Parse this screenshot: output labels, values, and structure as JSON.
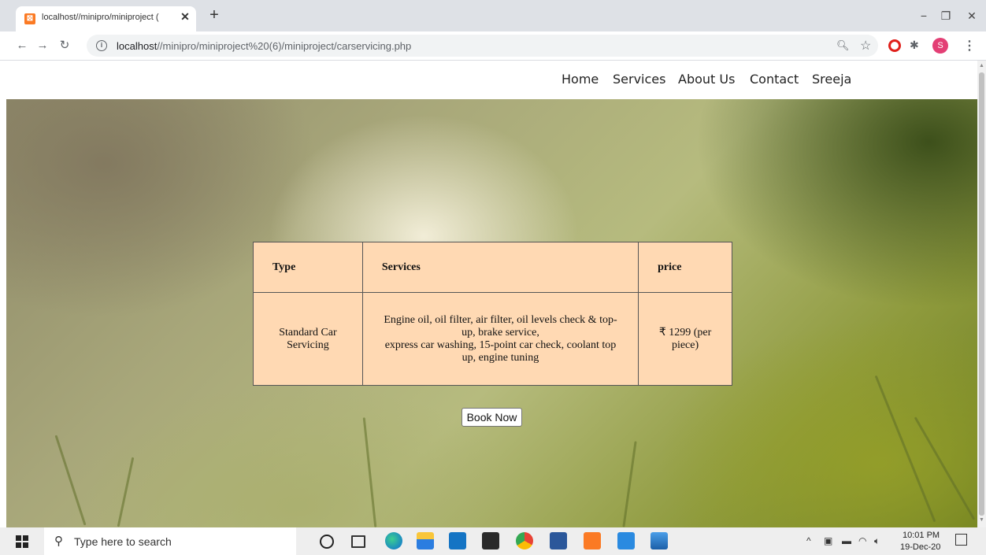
{
  "browser": {
    "tab_title": "localhost//minipro/miniproject (",
    "tab_close": "✕",
    "new_tab": "+",
    "url_host": "localhost",
    "url_path": "//minipro/miniproject%20(6)/miniproject/carservicing.php",
    "window_controls": {
      "minimize": "−",
      "maximize": "❐",
      "close": "✕"
    },
    "profile_initial": "S",
    "icons": [
      "back-arrow-icon",
      "forward-arrow-icon",
      "reload-icon",
      "info-icon",
      "zoom-icon",
      "star-icon",
      "opera-icon",
      "puzzle-icon",
      "menu-icon"
    ]
  },
  "site_nav": {
    "items": [
      "Home",
      "Services",
      "About Us",
      "Contact",
      "Sreeja"
    ]
  },
  "table": {
    "headers": {
      "type": "Type",
      "services": "Services",
      "price": "price"
    },
    "rows": [
      {
        "type": "Standard Car Servicing",
        "services_line1": "Engine oil, oil filter, air filter, oil levels check & top-up, brake service,",
        "services_line2": "express car washing, 15-point car check, coolant top up, engine tuning",
        "price": "₹ 1299 (per piece)"
      }
    ]
  },
  "book_button": "Book Now",
  "taskbar": {
    "search_placeholder": "Type here to search",
    "time": "10:01 PM",
    "date": "19-Dec-20",
    "tray_chevron": "^",
    "pinned_icons": [
      "cortana-icon",
      "task-view-icon",
      "edge-icon",
      "file-explorer-icon",
      "mail-icon",
      "store-icon",
      "chrome-icon",
      "word-icon",
      "xampp-icon",
      "vscode-icon",
      "photos-icon"
    ]
  },
  "colors": {
    "table_bg": "#ffd9b3",
    "tab_strip": "#dee1e6",
    "taskbar": "#eeeeee"
  }
}
